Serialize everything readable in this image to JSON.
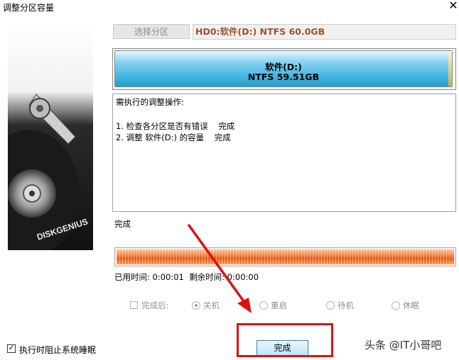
{
  "window": {
    "title": "调整分区容量",
    "close_icon": "close-icon"
  },
  "toolbar": {
    "select_partition_label": "选择分区"
  },
  "disk": {
    "info": "HD0:软件(D:) NTFS 60.0GB"
  },
  "partition": {
    "name": "软件(D:)",
    "size": "NTFS 59.51GB",
    "color": "#43b7e3"
  },
  "logo": {
    "text": "DISKGENIUS"
  },
  "operations": {
    "heading": "需执行的调整操作:",
    "items": [
      "1. 检查各分区是否有错误    完成",
      "2. 调整 软件(D:) 的容量    完成"
    ]
  },
  "status": {
    "text": "完成"
  },
  "progress": {
    "percent": 100,
    "color": "#f07a35"
  },
  "time": {
    "elapsed_label": "已用时间:",
    "elapsed_value": "0:00:01",
    "remaining_label": "剩余时间:",
    "remaining_value": "0:00:00"
  },
  "after_complete": {
    "label": "完成后:",
    "checked": false,
    "options": [
      {
        "label": "关机",
        "selected": true
      },
      {
        "label": "重启",
        "selected": false
      },
      {
        "label": "待机",
        "selected": false
      },
      {
        "label": "休眠",
        "selected": false
      }
    ]
  },
  "prevent_sleep": {
    "label": "执行时阻止系统睡眠",
    "checked": true
  },
  "finish_button": {
    "label": "完成"
  },
  "annotation": {
    "color": "#e01010"
  },
  "watermark": {
    "text": "头条 @IT小哥吧"
  }
}
